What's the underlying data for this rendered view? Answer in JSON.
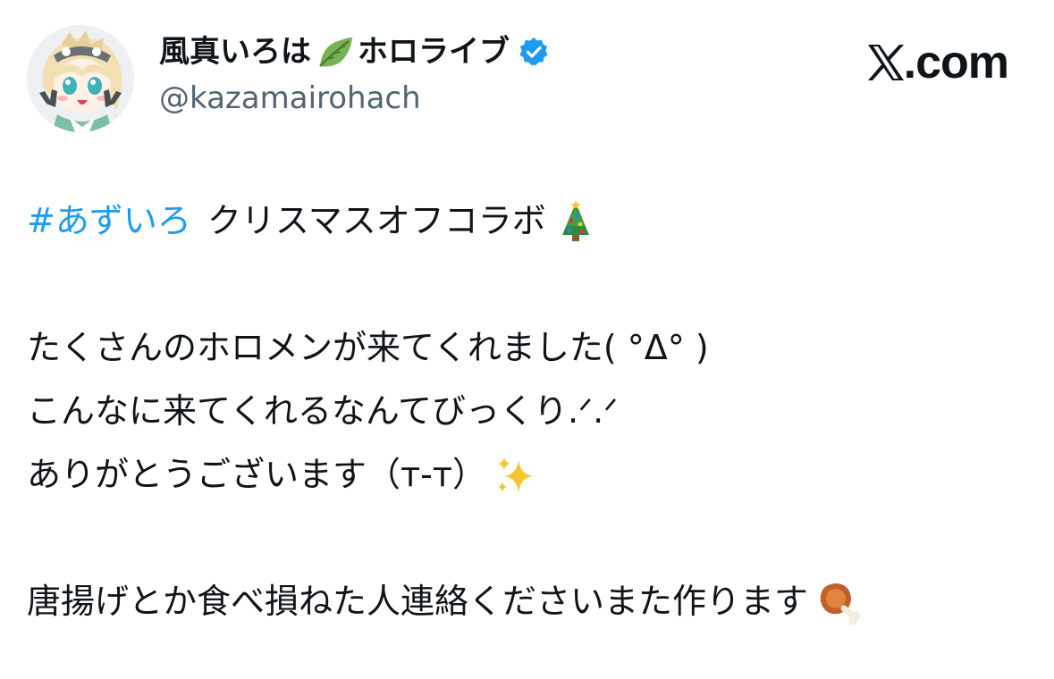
{
  "author": {
    "display_name_part1": "風真いろは",
    "leaf_icon": "leaf-icon",
    "display_name_part2": "ホロライブ",
    "verified_icon": "verified-badge-icon",
    "handle": "@kazamairohach",
    "avatar_icon": "avatar"
  },
  "brand": {
    "logo_icon": "x-logo-icon",
    "text": ".com"
  },
  "tweet": {
    "hashtag": "#あずいろ",
    "line1_text": "クリスマスオフコラボ",
    "line1_emoji": "christmas-tree-icon",
    "line2": "たくさんのホロメンが来てくれました( °Δ° )",
    "line3": "こんなに来てくれるなんてびっくり.ᐟ.ᐟ",
    "line4": "ありがとうございます（т-т）",
    "line4_emoji": "sparkles-icon",
    "line5": "唐揚げとか食べ損ねた人連絡くださいまた作ります",
    "line5_emoji": "meat-on-bone-icon"
  },
  "colors": {
    "hashtag": "#1d9bf0",
    "verified": "#1d9bf0",
    "handle": "#536471",
    "text": "#0f1419"
  }
}
